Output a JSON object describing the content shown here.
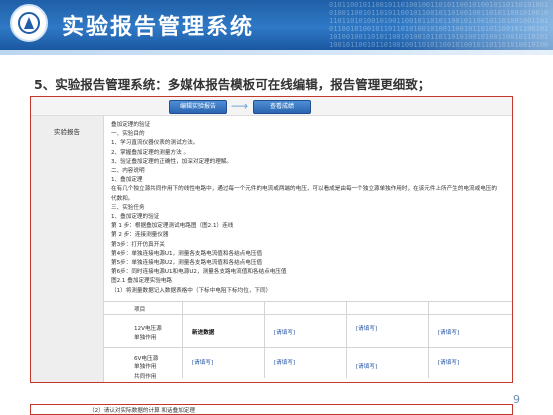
{
  "header": {
    "title": "实验报告管理系统",
    "digits": "0101100101100101101001001101011001010010110110101001010011001011010110010110010110100100110101100101001011011010100101001100101101011001011001011010010011010110010100101101101010010100110010110101100101100101101001001101011001010010110110101001010011001011010110010110010110100100110101100101001011011010100101001100101101"
  },
  "heading": "5、实验报告管理系统：多媒体报告模板可在线编辑，报告管理更细致；",
  "embedded": {
    "step1_label": "编辑实验报告",
    "step2_label": "查看成绩",
    "arrow": "⟶",
    "side_label": "实验报告",
    "lines": [
      "叠加定理的验证",
      "一、实验目的",
      "1、学习直流仪器仪表的测试方法。",
      "2、掌握叠加定理的测量方法 。",
      "3、验证叠加定理的正确性，加深对定理的理解。",
      "二、内容说明",
      "1、叠加定理",
      "在有几个独立源共同作用下的线性电路中，通过每一个元件的电流或两端的电压，可以看成是由每一个独立源单独作用时，在该元件上所产生的电流或电压的",
      "代数和。",
      "三、实验任务",
      "1、叠加定理的验证",
      "第 1 步：根据叠加定理测试电路图（图2.1）连线",
      "第 2 步：连接测量仪器",
      "第3步：打开仿真开关",
      "第4步：单独连接电源U1，测量各支路电流值和各结点电压值",
      "第5步：单独连接电源U2，测量各支路电流值和各结点电压值",
      "第6步：同时连接电源U1和电源U2，测量各支路电流值和各结点电压值",
      "图2.1 叠加定理实验电路",
      "（1）将测量数据记入数据表格中（下标中电阻下标均位，下同）"
    ],
    "table": {
      "header_label": "项目",
      "row1_label_a": "12V电压源",
      "row1_label_b": "单独作用",
      "row1_values": [
        "新进数据",
        "[请填写]",
        "[请填写]",
        "[请填写]"
      ],
      "row2_label_a": "6V电压源",
      "row2_label_b": "单独作用",
      "row2_values": [
        "[请填写]",
        "[请填写]",
        "[请填写]",
        "[请填写]"
      ],
      "row3_label": "共同作用"
    },
    "next_line": "（2）请认对实际数据的计算 和话叠加定理"
  },
  "page_number": "9",
  "colors": {
    "header_blue": "#2f79c6",
    "frame_red": "#c0392b",
    "link_blue": "#1f4f9f"
  }
}
